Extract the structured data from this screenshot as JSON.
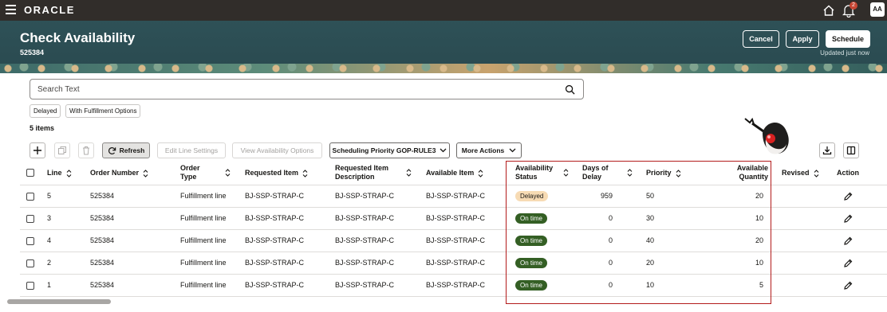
{
  "topbar": {
    "logo": "ORACLE",
    "notification_count": "2",
    "avatar_initials": "AA"
  },
  "header": {
    "title": "Check Availability",
    "order_number": "525384",
    "cancel_label": "Cancel",
    "apply_label": "Apply",
    "schedule_label": "Schedule",
    "updated_text": "Updated just now"
  },
  "search": {
    "placeholder": "Search Text"
  },
  "chips": [
    "Delayed",
    "With Fulfillment Options"
  ],
  "item_count": "5 items",
  "toolbar": {
    "refresh_label": "Refresh",
    "edit_line_settings_label": "Edit Line Settings",
    "view_availability_options_label": "View Availability Options",
    "scheduling_priority_label": "Scheduling Priority GOP-RULE3",
    "more_actions_label": "More Actions"
  },
  "table": {
    "headers": {
      "line": "Line",
      "order_number": "Order Number",
      "order_type": [
        "Order",
        "Type"
      ],
      "requested_item": "Requested Item",
      "requested_item_description": [
        "Requested Item",
        "Description"
      ],
      "available_item": "Available Item",
      "availability_status": [
        "Availability",
        "Status"
      ],
      "days_of_delay": [
        "Days of",
        "Delay"
      ],
      "priority": "Priority",
      "available_quantity": [
        "Available",
        "Quantity"
      ],
      "revised": "Revised",
      "action": "Action"
    },
    "rows": [
      {
        "line": "5",
        "order_number": "525384",
        "order_type": "Fulfillment line",
        "requested_item": "BJ-SSP-STRAP-C",
        "requested_item_description": "BJ-SSP-STRAP-C",
        "available_item": "BJ-SSP-STRAP-C",
        "status": "Delayed",
        "days_of_delay": "959",
        "priority": "50",
        "available_quantity": "20"
      },
      {
        "line": "3",
        "order_number": "525384",
        "order_type": "Fulfillment line",
        "requested_item": "BJ-SSP-STRAP-C",
        "requested_item_description": "BJ-SSP-STRAP-C",
        "available_item": "BJ-SSP-STRAP-C",
        "status": "On time",
        "days_of_delay": "0",
        "priority": "30",
        "available_quantity": "10"
      },
      {
        "line": "4",
        "order_number": "525384",
        "order_type": "Fulfillment line",
        "requested_item": "BJ-SSP-STRAP-C",
        "requested_item_description": "BJ-SSP-STRAP-C",
        "available_item": "BJ-SSP-STRAP-C",
        "status": "On time",
        "days_of_delay": "0",
        "priority": "40",
        "available_quantity": "20"
      },
      {
        "line": "2",
        "order_number": "525384",
        "order_type": "Fulfillment line",
        "requested_item": "BJ-SSP-STRAP-C",
        "requested_item_description": "BJ-SSP-STRAP-C",
        "available_item": "BJ-SSP-STRAP-C",
        "status": "On time",
        "days_of_delay": "0",
        "priority": "20",
        "available_quantity": "10"
      },
      {
        "line": "1",
        "order_number": "525384",
        "order_type": "Fulfillment line",
        "requested_item": "BJ-SSP-STRAP-C",
        "requested_item_description": "BJ-SSP-STRAP-C",
        "available_item": "BJ-SSP-STRAP-C",
        "status": "On time",
        "days_of_delay": "0",
        "priority": "10",
        "available_quantity": "5"
      }
    ]
  },
  "colors": {
    "topbar": "#312d2a",
    "header": "#2e5157",
    "delayed_pill": "#f7dbb4",
    "ontime_pill": "#345f24",
    "highlight_box": "#b31b1b"
  }
}
